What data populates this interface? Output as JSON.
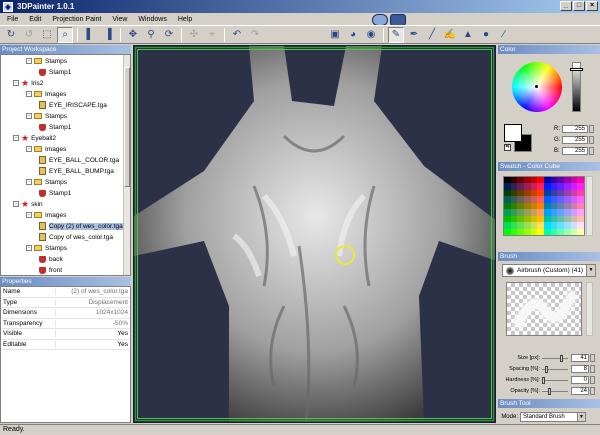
{
  "window": {
    "title": "3DPainter 1.0.1"
  },
  "menu": [
    "File",
    "Edit",
    "Projection Paint",
    "View",
    "Windows",
    "Help"
  ],
  "project_workspace": {
    "title": "Project Workspace",
    "tree": [
      {
        "level": 2,
        "type": "folder",
        "label": "Stamps",
        "exp": "-"
      },
      {
        "level": 3,
        "type": "stamp",
        "label": "Stamp1"
      },
      {
        "level": 1,
        "type": "object",
        "label": "Iris2",
        "exp": "-"
      },
      {
        "level": 2,
        "type": "folder",
        "label": "Images",
        "exp": "-"
      },
      {
        "level": 3,
        "type": "image",
        "label": "EYE_IRISCAPE.tga"
      },
      {
        "level": 2,
        "type": "folder",
        "label": "Stamps",
        "exp": "-"
      },
      {
        "level": 3,
        "type": "stamp",
        "label": "Stamp1"
      },
      {
        "level": 1,
        "type": "object",
        "label": "Eyeball2",
        "exp": "-"
      },
      {
        "level": 2,
        "type": "folder",
        "label": "Images",
        "exp": "-"
      },
      {
        "level": 3,
        "type": "image",
        "label": "EYE_BALL_COLOR.tga"
      },
      {
        "level": 3,
        "type": "image",
        "label": "EYE_BALL_BUMP.tga"
      },
      {
        "level": 2,
        "type": "folder",
        "label": "Stamps",
        "exp": "-"
      },
      {
        "level": 3,
        "type": "stamp",
        "label": "Stamp1"
      },
      {
        "level": 1,
        "type": "object",
        "label": "skin",
        "exp": "-"
      },
      {
        "level": 2,
        "type": "folder",
        "label": "Images",
        "exp": "-"
      },
      {
        "level": 3,
        "type": "image",
        "label": "Copy (2) of wes_color.tga",
        "selected": true
      },
      {
        "level": 3,
        "type": "image",
        "label": "Copy of wes_color.tga"
      },
      {
        "level": 2,
        "type": "folder",
        "label": "Stamps",
        "exp": "-"
      },
      {
        "level": 3,
        "type": "stamp",
        "label": "back"
      },
      {
        "level": 3,
        "type": "stamp",
        "label": "front"
      }
    ]
  },
  "properties": {
    "title": "Properties",
    "rows": [
      {
        "key": "Name",
        "value": "(2) of wes_color.tga"
      },
      {
        "key": "Type",
        "value": "Displacement"
      },
      {
        "key": "Dimensions",
        "value": "1024x1024"
      },
      {
        "key": "Transparency",
        "value": "-50%"
      },
      {
        "key": "Visible",
        "value": "Yes",
        "strong": true
      },
      {
        "key": "Editable",
        "value": "Yes",
        "strong": true
      }
    ]
  },
  "color_panel": {
    "title": "Color",
    "r_label": "R:",
    "g_label": "G:",
    "b_label": "B:",
    "r": "255",
    "g": "255",
    "b": "255"
  },
  "swatch_panel": {
    "title": "Swatch - Color Cube"
  },
  "brush_panel": {
    "title": "Brush",
    "selected_brush": "Airbrush (Custom) (41)",
    "size_fraction": 0.45,
    "sliders": [
      {
        "label": "Size [px]:",
        "value": "41",
        "knob": 0.78
      },
      {
        "label": "Spacing [%]:",
        "value": "8",
        "knob": 0.12
      },
      {
        "label": "Hardness [%]:",
        "value": "0",
        "knob": 0.0
      },
      {
        "label": "Opacity [%]:",
        "value": "24",
        "knob": 0.24
      }
    ]
  },
  "brush_tool_panel": {
    "title": "Brush Tool",
    "mode_label": "Mode:",
    "mode_value": "Standard Brush"
  },
  "status": {
    "text": "Ready."
  }
}
